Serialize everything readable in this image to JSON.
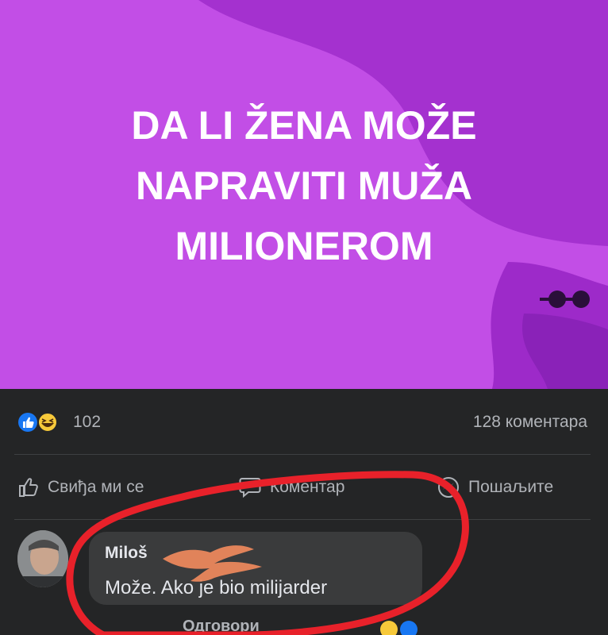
{
  "post": {
    "title_lines": [
      "DA LI ŽENA MOŽE",
      "NAPRAVITI MUŽA",
      "MILIONEROM"
    ],
    "background_color": "#c24ee6",
    "shape_color": "#9d2ac9"
  },
  "stats": {
    "reaction_icons": [
      "like-icon",
      "haha-icon"
    ],
    "reaction_count": "102",
    "comment_count": "128 коментара"
  },
  "actions": {
    "like_label": "Свиђа ми се",
    "comment_label": "Коментар",
    "send_label": "Пошаљите"
  },
  "comment": {
    "author": "Miloš",
    "text": "Može. Ako je bio milijarder",
    "reply_label": "Одговори"
  },
  "colors": {
    "dark_bg": "#242526",
    "bubble_bg": "#3a3b3c",
    "secondary_text": "#b0b3b8",
    "annotation_red": "#e8212a",
    "scribble_orange": "#f08a5d"
  }
}
